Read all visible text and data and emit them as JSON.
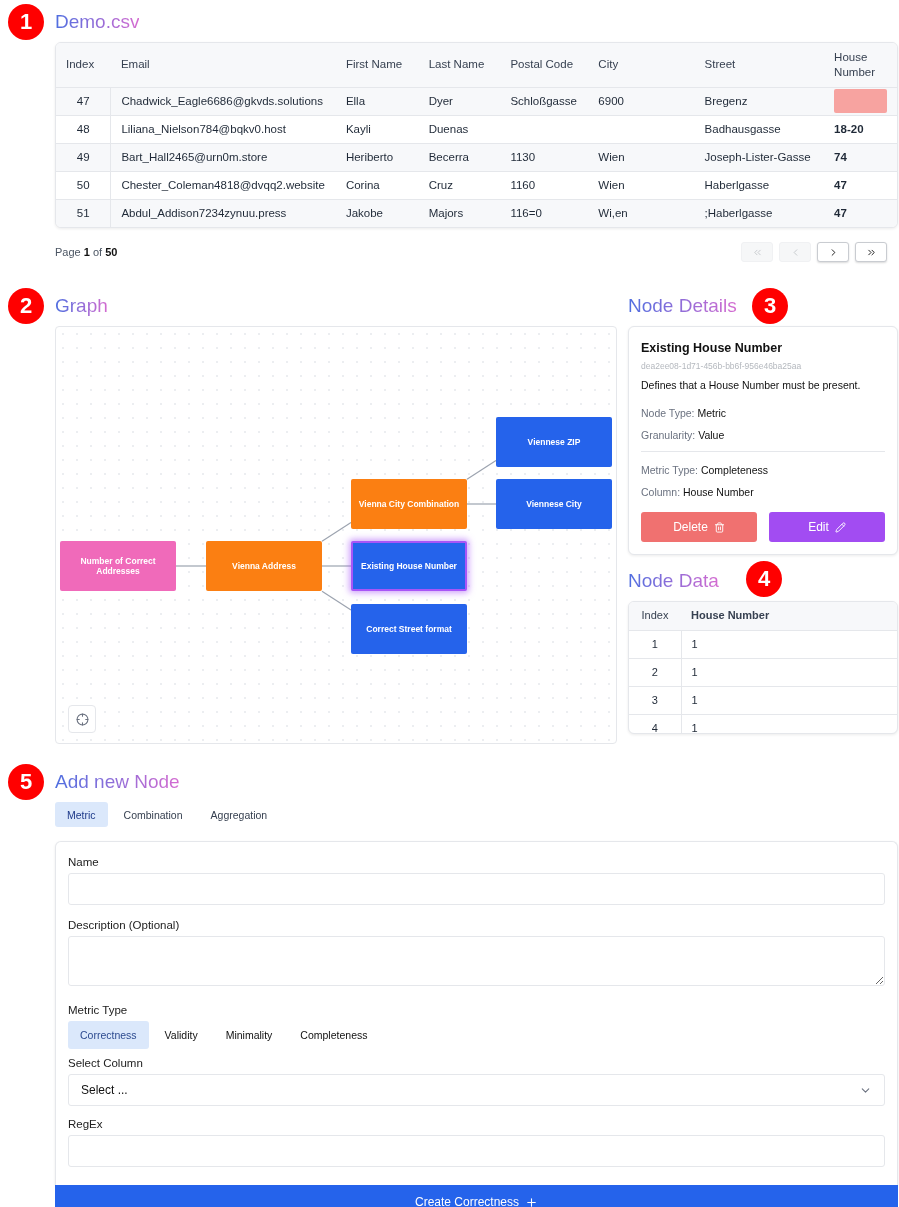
{
  "badges": [
    "1",
    "2",
    "3",
    "4",
    "5"
  ],
  "dataset": {
    "title": "Demo.csv",
    "columns": [
      "Index",
      "Email",
      "First Name",
      "Last Name",
      "Postal Code",
      "City",
      "Street",
      "House Number"
    ],
    "rows": [
      {
        "cells": [
          "47",
          "Chadwick_Eagle6686@gkvds.solutions",
          "Ella",
          "Dyer",
          "Schloßgasse",
          "6900",
          "Bregenz"
        ],
        "house_number": {
          "missing": true
        }
      },
      {
        "cells": [
          "48",
          "Liliana_Nielson784@bqkv0.host",
          "Kayli",
          "Duenas",
          "",
          "",
          "Badhausgasse"
        ],
        "house_number": {
          "missing": false,
          "text": "18-20"
        }
      },
      {
        "cells": [
          "49",
          "Bart_Hall2465@urn0m.store",
          "Heriberto",
          "Becerra",
          "1130",
          "Wien",
          "Joseph-Lister-Gasse"
        ],
        "house_number": {
          "missing": false,
          "text": "74"
        }
      },
      {
        "cells": [
          "50",
          "Chester_Coleman4818@dvqq2.website",
          "Corina",
          "Cruz",
          "1160",
          "Wien",
          "Haberlgasse"
        ],
        "house_number": {
          "missing": false,
          "text": "47"
        }
      },
      {
        "cells": [
          "51",
          "Abdul_Addison7234zynuu.press",
          "Jakobe",
          "Majors",
          "116=0",
          "Wi,en",
          ";Haberlgasse"
        ],
        "house_number": {
          "missing": false,
          "text": "47"
        }
      }
    ],
    "pagination": {
      "text": "Page **1** of **50**",
      "buttons": [
        {
          "kind": "first",
          "disabled": true
        },
        {
          "kind": "prev",
          "disabled": true
        },
        {
          "kind": "next",
          "disabled": false
        },
        {
          "kind": "last",
          "disabled": false
        }
      ]
    }
  },
  "graph": {
    "title": "Graph",
    "nodes": [
      {
        "kind": "aggregation",
        "title": "Number of Correct Addresses",
        "selected": false
      },
      {
        "kind": "combination",
        "title": "Vienna Address",
        "selected": false
      },
      {
        "kind": "combination",
        "title": "Vienna City Combination",
        "selected": false
      },
      {
        "kind": "metric",
        "title": "Existing House Number",
        "selected": true
      },
      {
        "kind": "metric",
        "title": "Correct Street format",
        "selected": false
      },
      {
        "kind": "metric",
        "title": "Viennese ZIP",
        "selected": false
      },
      {
        "kind": "metric",
        "title": "Viennese City",
        "selected": false
      }
    ]
  },
  "node_details": {
    "title": "Node Details",
    "name": "Existing House Number",
    "id": "dea2ee08-1d71-456b-bb6f-956e46ba25aa",
    "description": "Defines that a House Number must be present.",
    "groups": [
      [
        {
          "label": "Node Type:",
          "value": "Metric"
        },
        {
          "label": "Granularity:",
          "value": "Value"
        }
      ],
      [
        {
          "label": "Metric Type:",
          "value": "Completeness"
        },
        {
          "label": "Column:",
          "value": "House Number"
        }
      ]
    ],
    "delete_label": "Delete",
    "edit_label": "Edit"
  },
  "node_data": {
    "title": "Node Data",
    "columns": [
      "Index",
      "House Number"
    ],
    "rows": [
      [
        "1",
        "1"
      ],
      [
        "2",
        "1"
      ],
      [
        "3",
        "1"
      ],
      [
        "4",
        "1"
      ]
    ]
  },
  "add_node": {
    "title": "Add new Node",
    "tabs": [
      {
        "label": "Metric",
        "selected": true
      },
      {
        "label": "Combination",
        "selected": false
      },
      {
        "label": "Aggregation",
        "selected": false
      }
    ],
    "name_label": "Name",
    "description_label": "Description (Optional)",
    "metric_type_label": "Metric Type",
    "metric_types": [
      {
        "label": "Correctness",
        "selected": true
      },
      {
        "label": "Validity",
        "selected": false
      },
      {
        "label": "Minimality",
        "selected": false
      },
      {
        "label": "Completeness",
        "selected": false
      }
    ],
    "column_label": "Select Column",
    "column_value": "Select ...",
    "regex_label": "RegEx",
    "submit": "Create Correctness"
  }
}
